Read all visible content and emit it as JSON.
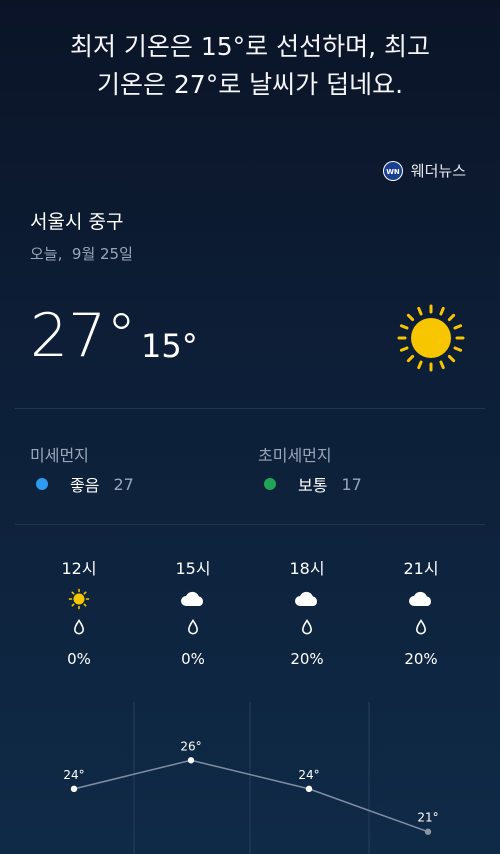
{
  "headline": {
    "line1": "최저 기온은 15°로 선선하며, 최고",
    "line2": "기온은 27°로 날씨가 덥네요."
  },
  "provider": {
    "name": "웨더뉴스",
    "logo_text": "WN",
    "icon": "weathernews-logo-icon"
  },
  "location": "서울시 중구",
  "date": "오늘,  9월 25일",
  "temperature": {
    "high": "27°",
    "low": "15°",
    "condition_icon": "sun-icon"
  },
  "air_quality": [
    {
      "title": "미세먼지",
      "status": "좋음",
      "value": "27",
      "color": "#2f9bf0"
    },
    {
      "title": "초미세먼지",
      "status": "보통",
      "value": "17",
      "color": "#21a455"
    }
  ],
  "hourly": [
    {
      "time": "12시",
      "icon": "sun-icon",
      "precip_icon": "raindrop-icon",
      "precip": "0%",
      "temp": "24°",
      "temp_value": 24
    },
    {
      "time": "15시",
      "icon": "cloud-icon",
      "precip_icon": "raindrop-icon",
      "precip": "0%",
      "temp": "26°",
      "temp_value": 26
    },
    {
      "time": "18시",
      "icon": "cloud-icon",
      "precip_icon": "raindrop-icon",
      "precip": "20%",
      "temp": "24°",
      "temp_value": 24
    },
    {
      "time": "21시",
      "icon": "cloud-icon",
      "precip_icon": "raindrop-icon",
      "precip": "20%",
      "temp": "21°",
      "temp_value": 21
    }
  ],
  "colors": {
    "sun": "#f7c600",
    "graph_line": "#7f8ea3",
    "point": "#ffffff",
    "last_point": "#8a96a8"
  }
}
